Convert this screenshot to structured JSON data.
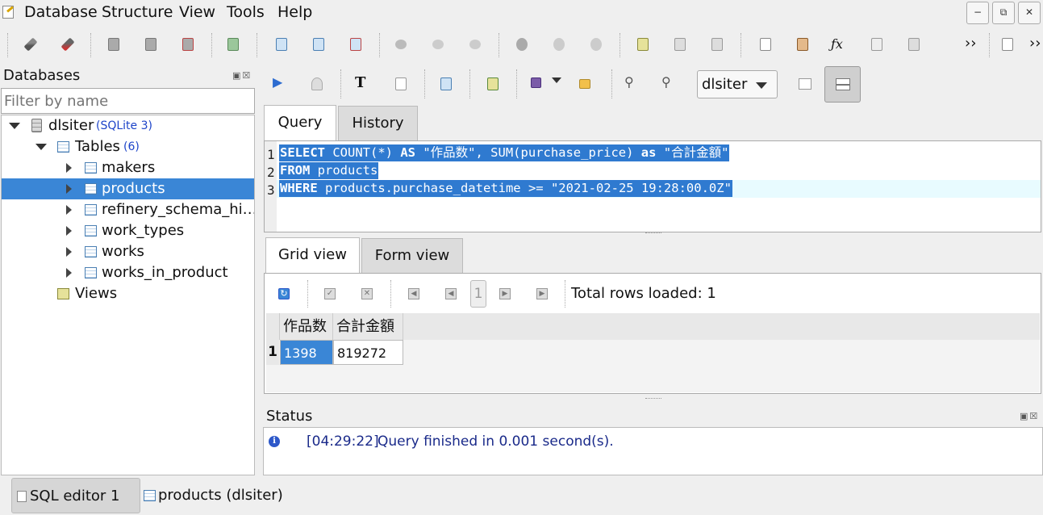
{
  "menu": {
    "items": [
      "Database",
      "Structure",
      "View",
      "Tools",
      "Help"
    ]
  },
  "window_controls": [
    "minimize",
    "restore",
    "close"
  ],
  "databases_panel": {
    "title": "Databases",
    "filter_placeholder": "Filter by name",
    "tree": {
      "db_name": "dlsiter",
      "db_type": "(SQLite 3)",
      "tables_label": "Tables",
      "tables_count": "(6)",
      "tables": [
        "makers",
        "products",
        "refinery_schema_hi…",
        "work_types",
        "works",
        "works_in_product"
      ],
      "selected_table": "products",
      "views_label": "Views"
    }
  },
  "sql_toolbar": {
    "db_select": "dlsiter"
  },
  "editor_tabs": {
    "query": "Query",
    "history": "History"
  },
  "editor": {
    "line_numbers": [
      "1",
      "2",
      "3"
    ],
    "lines": [
      "SELECT COUNT(*) AS \"作品数\", SUM(purchase_price) as \"合計金額\"",
      "FROM products",
      "WHERE products.purchase_datetime >= \"2021-02-25 19:28:00.0Z\""
    ]
  },
  "result_tabs": {
    "grid": "Grid view",
    "form": "Form view"
  },
  "results": {
    "page_number": "1",
    "total_rows_label": "Total rows loaded: 1",
    "columns": [
      "作品数",
      "合計金額"
    ],
    "row_number": "1",
    "row": [
      "1398",
      "819272"
    ]
  },
  "status": {
    "title": "Status",
    "time": "[04:29:22]",
    "message": "Query finished in 0.001 second(s)."
  },
  "bottom_tabs": [
    "SQL editor 1",
    "products (dlsiter)"
  ]
}
